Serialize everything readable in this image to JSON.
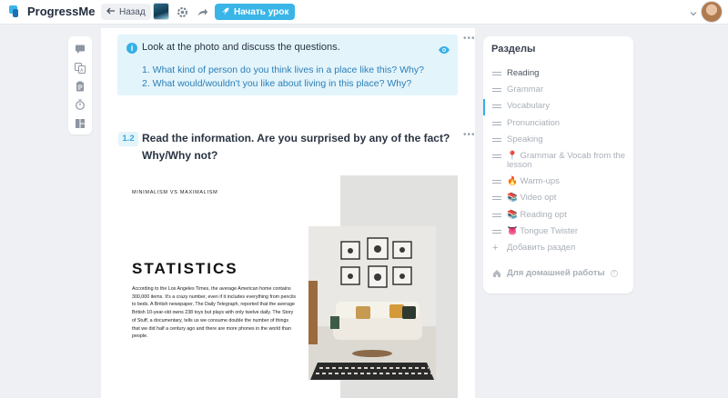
{
  "app": {
    "name": "ProgressMe"
  },
  "toolbar": {
    "back_label": "Назад",
    "start_label": "Начать урок"
  },
  "task1": {
    "title": "Look at the photo and discuss the questions.",
    "questions": [
      "1. What kind of person do you think lives in a place like this? Why?",
      "2. What would/wouldn't you like about living in this place? Why?"
    ]
  },
  "task2": {
    "number": "1.2",
    "title": "Read the information. Are you surprised by any of the fact? Why/Why not?"
  },
  "poster": {
    "kicker": "MINIMALISM VS MAXIMALISM",
    "heading": "STATISTICS",
    "body": "According to the Los Angeles Times, the average American home contains 300,000 items. It's a crazy number, even if it includes everything from pencils to beds. A British newspaper, The Daily Telegraph, reported that the average British 10-year-old owns 238 toys but plays with only twelve daily. The Story of Stuff, a documentary, tells us we consume double the number of things that we did half a century ago and there are more phones in the world than people."
  },
  "sidebar": {
    "title": "Разделы",
    "items": [
      {
        "label": "Reading",
        "active": true
      },
      {
        "label": "Grammar"
      },
      {
        "label": "Vocabulary"
      },
      {
        "label": "Pronunciation"
      },
      {
        "label": "Speaking"
      },
      {
        "label": "📍 Grammar & Vocab from the lesson"
      },
      {
        "label": "🔥 Warm-ups"
      },
      {
        "label": "📚 Video opt"
      },
      {
        "label": "📚 Reading opt"
      },
      {
        "label": "👅 Tongue Twister"
      }
    ],
    "add_label": "Добавить раздел",
    "homework_label": "Для домашней работы"
  },
  "colors": {
    "accent": "#35b0e4",
    "task_bg": "#e3f4fb",
    "question_text": "#2b7fb8"
  }
}
